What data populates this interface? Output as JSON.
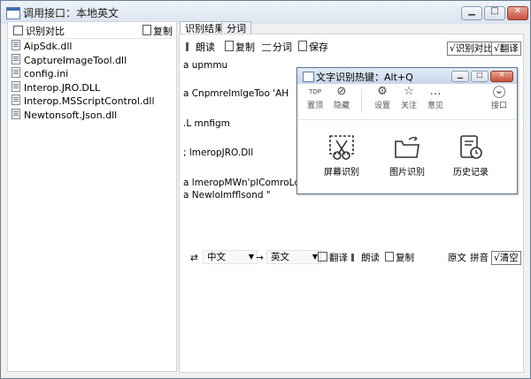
{
  "window": {
    "title": "调用接口：本地英文"
  },
  "left_panel": {
    "compare_label": "识别对比",
    "copy_label": "复制",
    "files": [
      "AipSdk.dll",
      "CaptureImageTool.dll",
      "config.ini",
      "Interop.JRO.DLL",
      "Interop.MSScriptControl.dll",
      "Newtonsoft.Json.dll"
    ]
  },
  "tabs": [
    "识别结果",
    "分词"
  ],
  "toolbar": {
    "read": "朗读",
    "copy": "复制",
    "segment": "分词",
    "save": "保存",
    "compare_btn": "√识别对比",
    "translate_btn": "√翻译"
  },
  "result_lines": [
    "a upmmu",
    "a CnpmrelmlgeToo  'AH",
    ".L mnfigm",
    "; lmeropJRO.Dll",
    "a lmeropMWn'plComroLdH",
    "a Newlolmfflsond  \""
  ],
  "popup": {
    "title": "文字识别热键：Alt+Q",
    "tools": [
      {
        "icon": "top-icon",
        "symbol": "TOP",
        "label": "置顶"
      },
      {
        "icon": "hide-icon",
        "symbol": "⊘",
        "label": "隐藏"
      },
      {
        "icon": "settings-icon",
        "symbol": "⚙",
        "label": "设置"
      },
      {
        "icon": "star-icon",
        "symbol": "☆",
        "label": "关注"
      },
      {
        "icon": "feedback-icon",
        "symbol": "…",
        "label": "意见"
      },
      {
        "icon": "chevron-down-icon",
        "symbol": "⌄",
        "label": "接口"
      }
    ],
    "actions": [
      {
        "icon": "scissors-icon",
        "label": "屏幕识别"
      },
      {
        "icon": "folder-icon",
        "label": "图片识别"
      },
      {
        "icon": "history-icon",
        "label": "历史记录"
      }
    ]
  },
  "translate_bar": {
    "source_lang": "中文",
    "arrow": "→",
    "target_lang": "英文",
    "translate": "翻译",
    "read": "朗读",
    "copy": "复制",
    "original": "原文",
    "pinyin": "拼音",
    "clear": "√清空"
  }
}
